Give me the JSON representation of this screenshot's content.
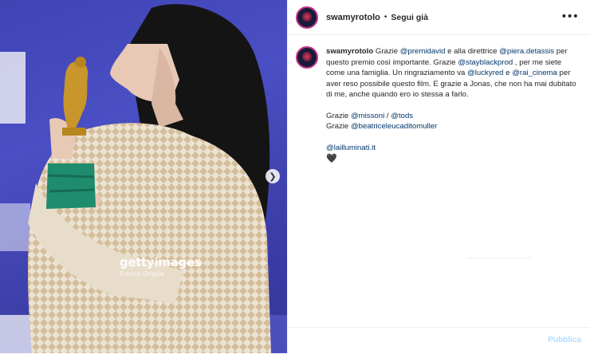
{
  "photo": {
    "next_icon": "chevron-right-icon",
    "next_glyph": "❯",
    "watermark": "gettyimages",
    "credit": "Franco Origlia"
  },
  "post": {
    "username": "swamyrotolo",
    "separator": "•",
    "follow_label": "Segui già",
    "more_glyph": "•••"
  },
  "caption": {
    "username": "swamyrotolo",
    "t1": " Grazie ",
    "m1": "@premidavid",
    "t2": " e alla direttrice ",
    "m2": "@piera.detassis",
    "t3": " per questo premio così importante. Grazie ",
    "m3": "@stayblackprod",
    "t4": " , per me siete come una famiglia. Un ringraziamento va ",
    "m4": "@luckyred",
    "t5": " e ",
    "m5": "@rai_cinema",
    "t6": " per aver reso possibile questo film. E grazie a Jonas, che non ha mai dubitato di me, anche quando ero io stessa a farlo.",
    "l2_t1": "Grazie ",
    "l2_m1": "@missoni",
    "l2_t2": " / ",
    "l2_m2": "@tods",
    "l3_t1": "Grazie ",
    "l3_m1": "@beatriceleucaditomuller",
    "m_last": "@lailluminati.it",
    "heart": "🖤"
  },
  "footer": {
    "publish_label": "Pubblica"
  },
  "colors": {
    "link": "#00376b",
    "publish_disabled": "#b3dbff",
    "backdrop": "#4a4fc4"
  }
}
